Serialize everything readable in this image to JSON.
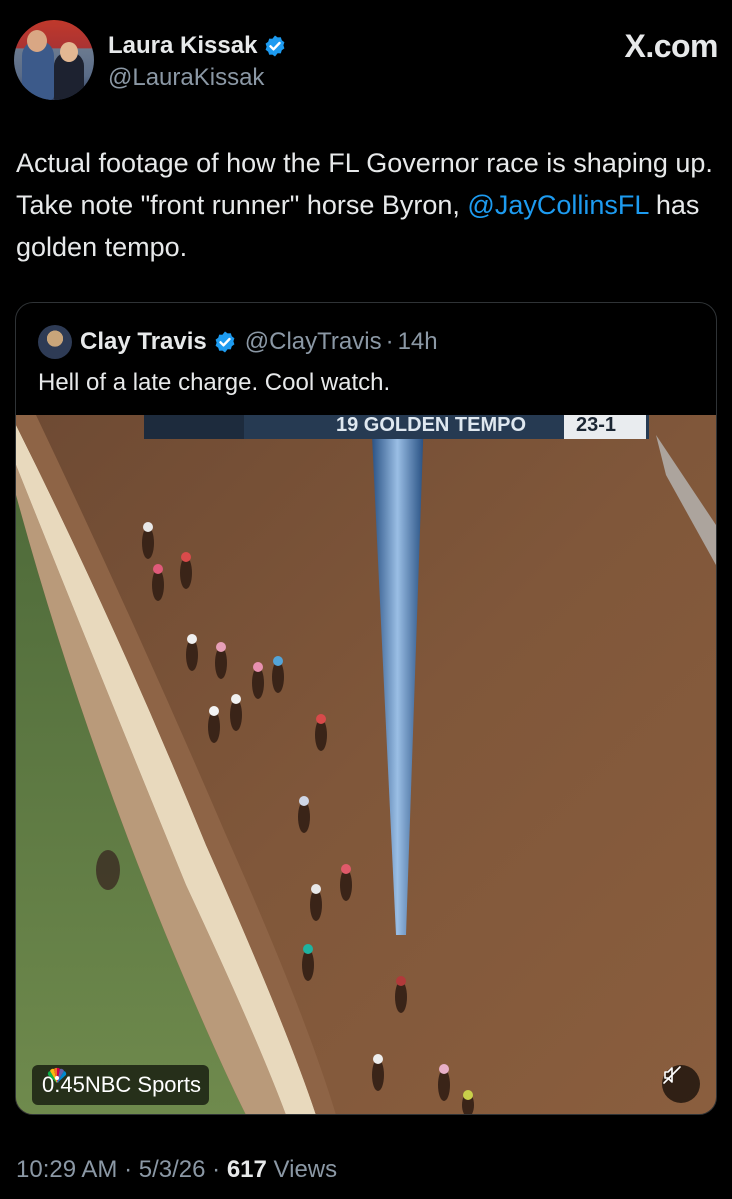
{
  "author": {
    "display_name": "Laura Kissak",
    "handle": "@LauraKissak",
    "verified": true
  },
  "brand": "X.com",
  "tweet": {
    "text_before": "Actual footage of how the FL Governor race is shaping up. Take note \"front runner\" horse Byron, ",
    "mention": "@JayCollinsFL",
    "text_after": " has golden tempo."
  },
  "quoted": {
    "display_name": "Clay Travis",
    "handle": "@ClayTravis",
    "separator": "·",
    "age": "14h",
    "text": "Hell of a late charge. Cool watch."
  },
  "video": {
    "duration": "0:45",
    "network": "NBC Sports",
    "banner_text": "19 GOLDEN TEMPO",
    "banner_odds": "23-1",
    "muted": true
  },
  "meta": {
    "time": "10:29 AM",
    "sep1": "·",
    "date": "5/3/26",
    "sep2": "·",
    "views_count": "617",
    "views_label": "Views"
  },
  "colors": {
    "background": "#000000",
    "text": "#e7e9ea",
    "secondary": "#8b98a5",
    "link": "#1d9bf0",
    "verified": "#1d9bf0"
  }
}
